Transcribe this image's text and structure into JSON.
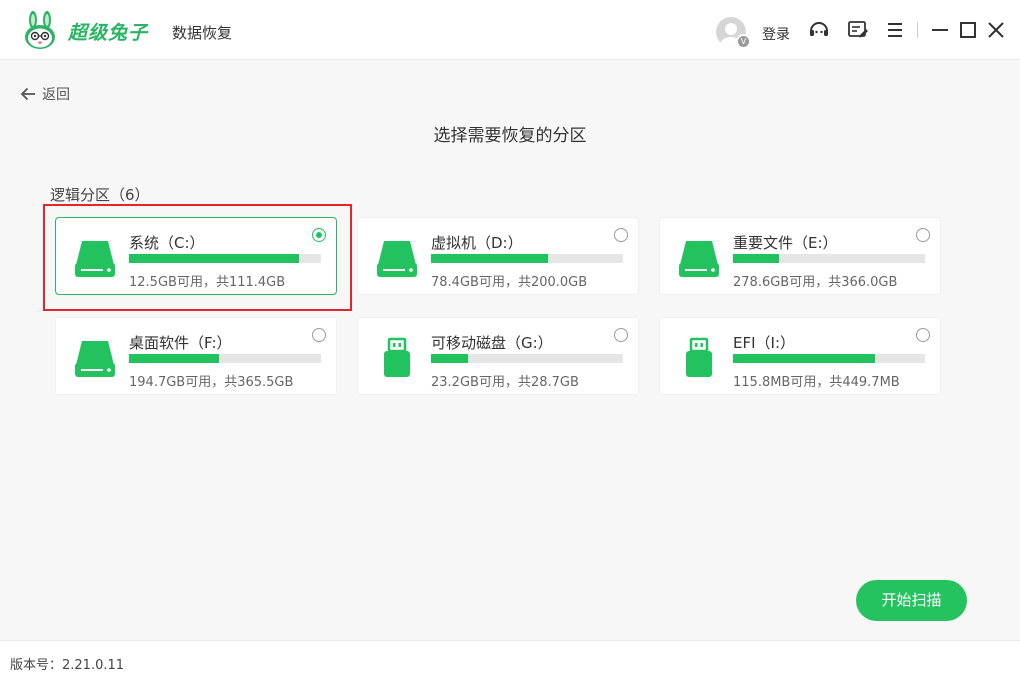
{
  "app": {
    "brand": "超级兔子",
    "subtitle": "数据恢复",
    "login_label": "登录",
    "avatar_badge": "V"
  },
  "nav": {
    "back_label": "返回"
  },
  "page": {
    "title": "选择需要恢复的分区",
    "section_label": "逻辑分区（6）"
  },
  "partitions": [
    {
      "name": "系统（C:）",
      "size": "12.5GB可用，共111.4GB",
      "used_fraction": 0.888,
      "icon": "hard-drive-icon",
      "selected": true
    },
    {
      "name": "虚拟机（D:）",
      "size": "78.4GB可用，共200.0GB",
      "used_fraction": 0.608,
      "icon": "hard-drive-icon",
      "selected": false
    },
    {
      "name": "重要文件（E:）",
      "size": "278.6GB可用，共366.0GB",
      "used_fraction": 0.239,
      "icon": "hard-drive-icon",
      "selected": false
    },
    {
      "name": "桌面软件（F:）",
      "size": "194.7GB可用，共365.5GB",
      "used_fraction": 0.467,
      "icon": "hard-drive-icon",
      "selected": false
    },
    {
      "name": "可移动磁盘（G:）",
      "size": "23.2GB可用，共28.7GB",
      "used_fraction": 0.192,
      "icon": "usb-drive-icon",
      "selected": false
    },
    {
      "name": "EFI（I:）",
      "size": "115.8MB可用，共449.7MB",
      "used_fraction": 0.742,
      "icon": "usb-drive-icon",
      "selected": false
    }
  ],
  "actions": {
    "scan_label": "开始扫描"
  },
  "footer": {
    "version": "版本号：2.21.0.11"
  },
  "colors": {
    "accent": "#22c25f",
    "highlight": "#e3262c"
  }
}
